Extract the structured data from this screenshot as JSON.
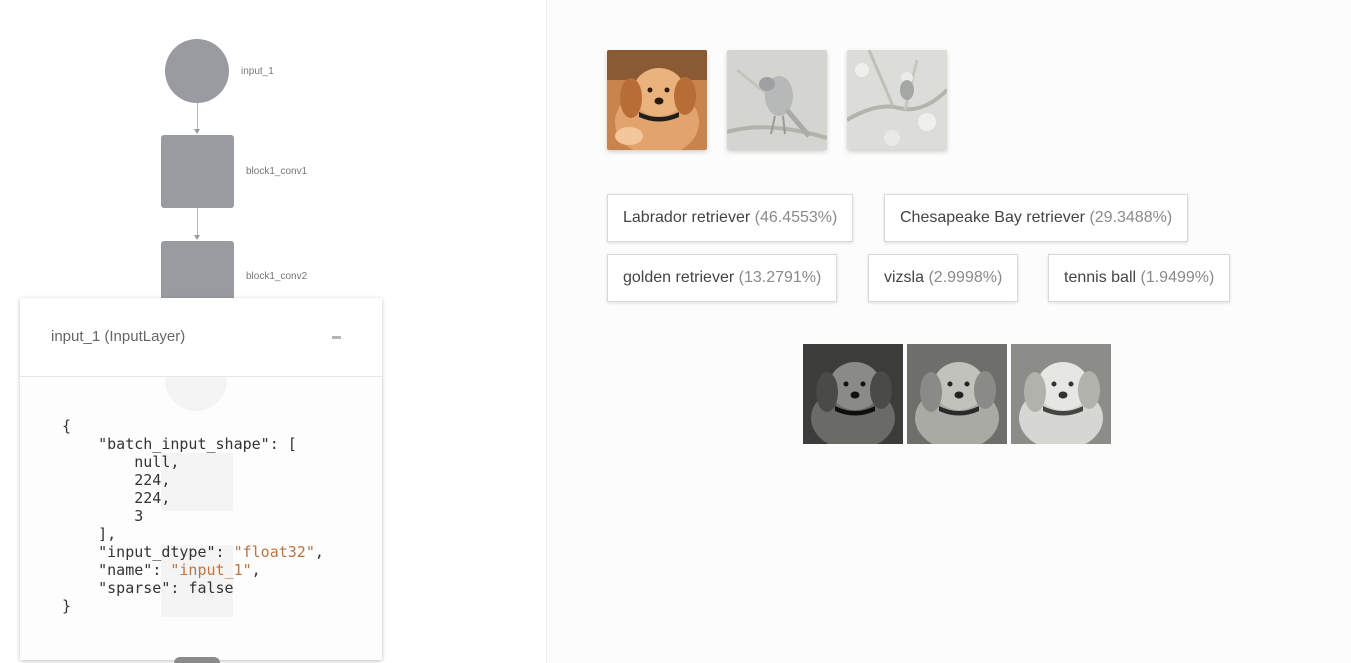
{
  "graph": {
    "nodes": [
      {
        "label": "input_1",
        "shape": "circle"
      },
      {
        "label": "block1_conv1",
        "shape": "rect"
      },
      {
        "label": "block1_conv2",
        "shape": "rect"
      }
    ]
  },
  "details_panel": {
    "title": "input_1 (InputLayer)",
    "collapse_icon": "minus-icon",
    "config": {
      "open": "{",
      "batch_key": "\"batch_input_shape\"",
      "batch_values": [
        "null",
        "224",
        "224",
        "3"
      ],
      "dtype_key": "\"input_dtype\"",
      "dtype_value": "\"float32\"",
      "name_key": "\"name\"",
      "name_value": "\"input_1\"",
      "sparse_key": "\"sparse\"",
      "sparse_value": "false",
      "close": "}"
    }
  },
  "image_picker": {
    "thumbnails": [
      {
        "name": "puppy",
        "selected": true
      },
      {
        "name": "bird",
        "selected": false
      },
      {
        "name": "snow-branch",
        "selected": false
      }
    ]
  },
  "predictions": [
    {
      "label": "Labrador retriever",
      "percent": "(46.4553%)"
    },
    {
      "label": "Chesapeake Bay retriever",
      "percent": "(29.3488%)"
    },
    {
      "label": "golden retriever",
      "percent": "(13.2791%)"
    },
    {
      "label": "vizsla",
      "percent": "(2.9998%)"
    },
    {
      "label": "tennis ball",
      "percent": "(1.9499%)"
    }
  ],
  "variants": [
    {
      "name": "dark-variant"
    },
    {
      "name": "medium-variant"
    },
    {
      "name": "light-variant"
    }
  ],
  "colors": {
    "node": "#9a9ba0",
    "string_token": "#c0733f",
    "percent_text": "#8a8a8a"
  }
}
